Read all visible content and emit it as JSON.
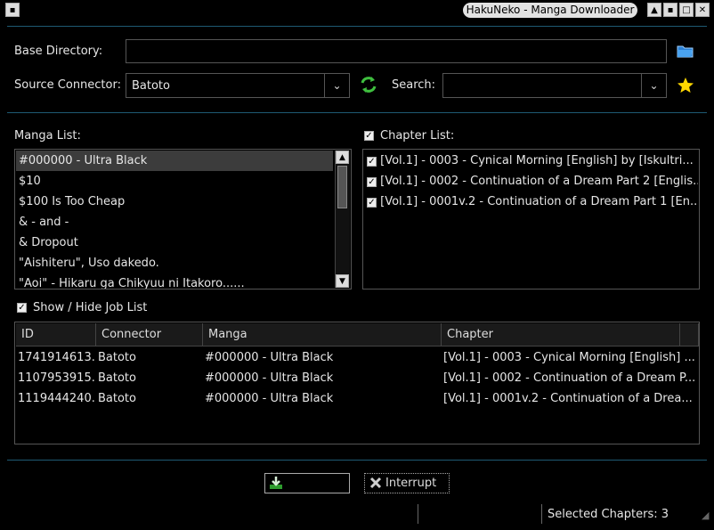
{
  "window": {
    "title": "HakuNeko - Manga Downloader",
    "minimize_glyph": "▲",
    "restore_glyph": "▪",
    "maximize_glyph": "□",
    "close_glyph": "✕"
  },
  "base_directory": {
    "label": "Base Directory:",
    "value": ""
  },
  "source_connector": {
    "label": "Source Connector:",
    "value": "Batoto"
  },
  "search": {
    "label": "Search:",
    "value": ""
  },
  "manga_list": {
    "label": "Manga List:",
    "items": [
      "#000000 - Ultra Black",
      "$10",
      "$100 Is Too Cheap",
      "& - and -",
      "& Dropout",
      "\"Aishiteru\", Uso dakedo.",
      "\"Aoi\" - Hikaru ga Chikyuu ni Itakoro......"
    ]
  },
  "chapter_list": {
    "label": "Chapter List:",
    "items": [
      "[Vol.1] - 0003 - Cynical Morning [English] by [Iskultri...",
      "[Vol.1] - 0002 - Continuation of a Dream Part 2 [Englis...",
      "[Vol.1] - 0001v.2 - Continuation of a Dream Part 1 [En..."
    ]
  },
  "job_list": {
    "toggle_label": "Show / Hide Job List",
    "columns": [
      "ID",
      "Connector",
      "Manga",
      "Chapter"
    ],
    "rows": [
      [
        "1741914613...",
        "Batoto",
        "#000000 - Ultra Black",
        "[Vol.1] - 0003 - Cynical Morning [English] ..."
      ],
      [
        "1107953915...",
        "Batoto",
        "#000000 - Ultra Black",
        "[Vol.1] - 0002 - Continuation of a Dream P..."
      ],
      [
        "1119444240...",
        "Batoto",
        "#000000 - Ultra Black",
        "[Vol.1] - 0001v.2 - Continuation of a Drea..."
      ]
    ]
  },
  "actions": {
    "download_label": "",
    "interrupt_label": "Interrupt"
  },
  "status": {
    "selected_chapters": "Selected Chapters: 3"
  }
}
